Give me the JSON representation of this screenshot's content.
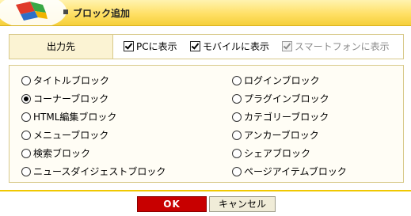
{
  "dialog": {
    "title": "ブロック追加"
  },
  "output": {
    "label": "出力先",
    "options": [
      {
        "label": "PCに表示",
        "checked": true,
        "disabled": false
      },
      {
        "label": "モバイルに表示",
        "checked": true,
        "disabled": false
      },
      {
        "label": "スマートフォンに表示",
        "checked": true,
        "disabled": true
      }
    ]
  },
  "blocks": {
    "selected": "コーナーブロック",
    "left": [
      "タイトルブロック",
      "コーナーブロック",
      "HTML編集ブロック",
      "メニューブロック",
      "検索ブロック",
      "ニュースダイジェストブロック"
    ],
    "right": [
      "ログインブロック",
      "プラグインブロック",
      "カテゴリーブロック",
      "アンカーブロック",
      "シェアブロック",
      "ページアイテムブロック"
    ]
  },
  "buttons": {
    "ok": "OK",
    "cancel": "キャンセル"
  },
  "colors": {
    "titlebar": "#ffe066",
    "ok_button": "#c80000",
    "accent_line": "#f0c800"
  }
}
